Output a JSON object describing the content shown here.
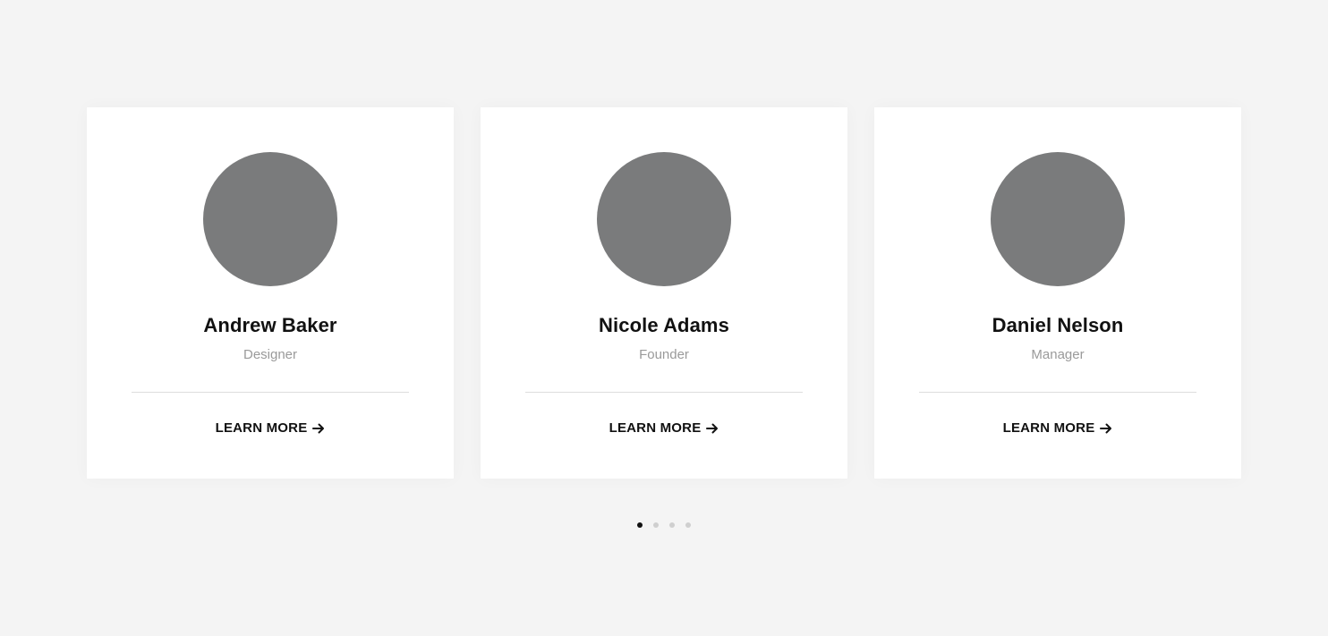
{
  "team": {
    "members": [
      {
        "name": "Andrew Baker",
        "role": "Designer",
        "cta": "LEARN MORE"
      },
      {
        "name": "Nicole Adams",
        "role": "Founder",
        "cta": "LEARN MORE"
      },
      {
        "name": "Daniel Nelson",
        "role": "Manager",
        "cta": "LEARN MORE"
      }
    ]
  },
  "pagination": {
    "count": 4,
    "active": 1
  },
  "icons": {
    "cta": "arrow-right-icon"
  },
  "colors": {
    "background": "#f4f4f4",
    "card": "#ffffff",
    "avatar": "#7a7b7c",
    "text": "#111111",
    "muted": "#9a9a9a",
    "dot_active": "#111111",
    "dot_inactive": "#cfcfcf"
  }
}
